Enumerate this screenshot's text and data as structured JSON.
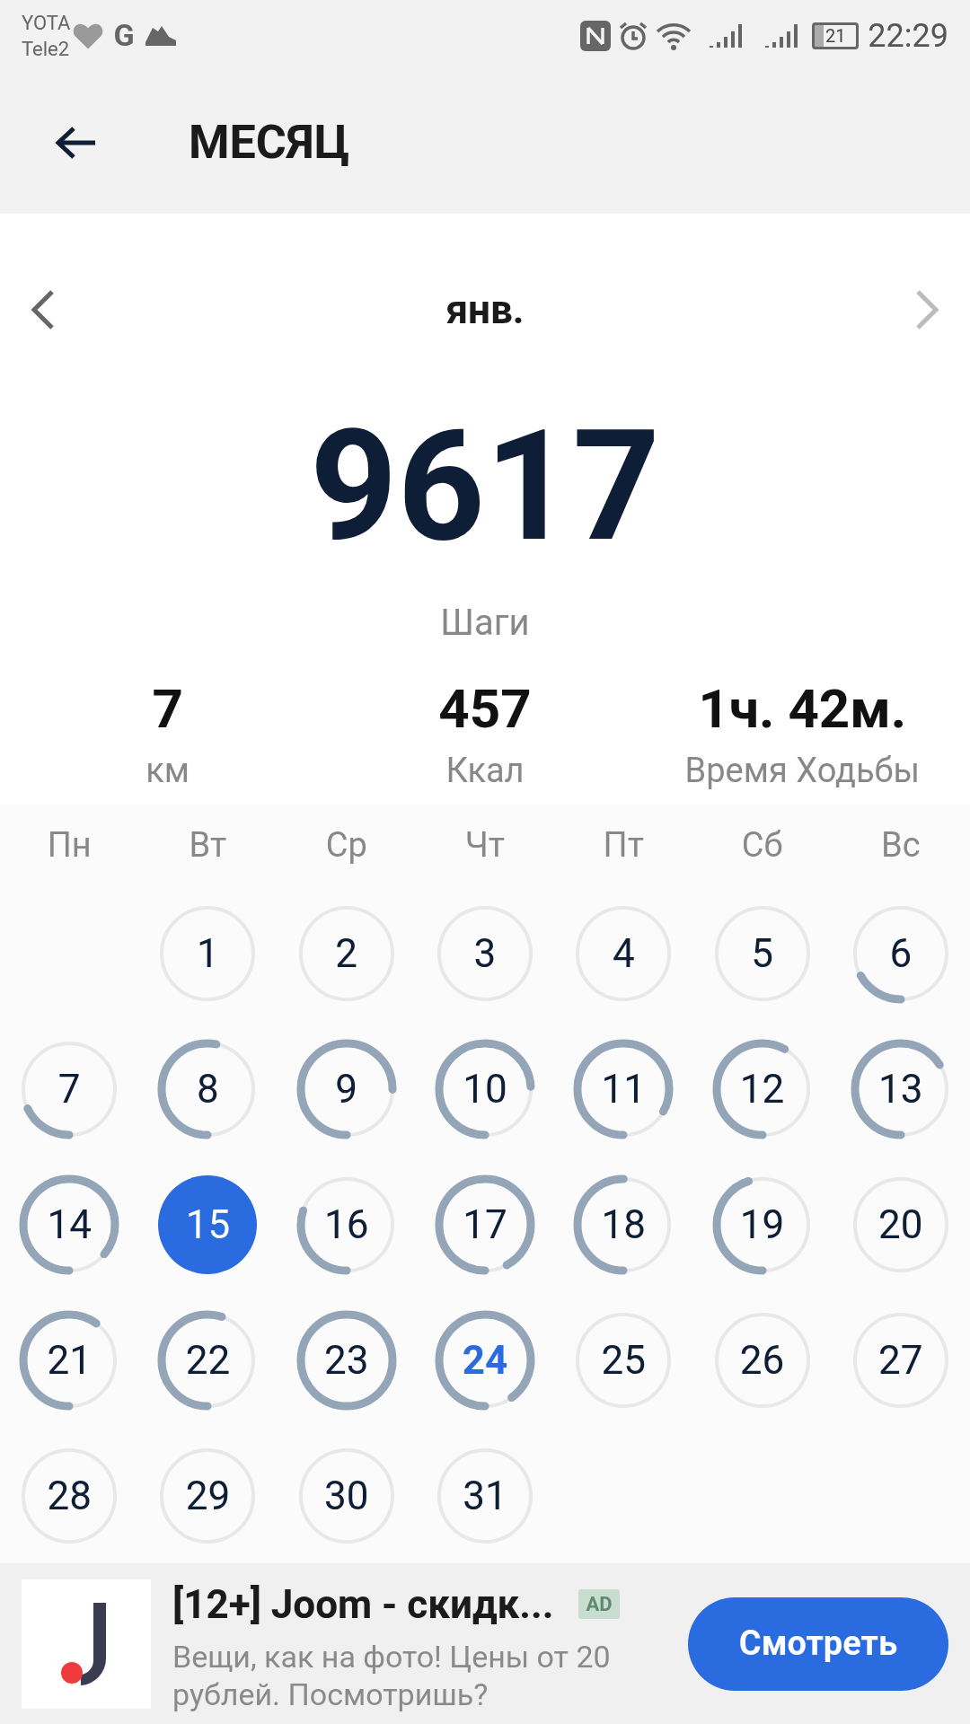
{
  "status_bar": {
    "carrier_1": "YOTA",
    "carrier_2": "Tele2",
    "g_icon": "G",
    "battery": "21",
    "time": "22:29"
  },
  "header": {
    "title": "МЕСЯЦ"
  },
  "month": {
    "label": "янв."
  },
  "summary": {
    "steps": "9617",
    "steps_label": "Шаги",
    "stats": [
      {
        "value": "7",
        "label": "км"
      },
      {
        "value": "457",
        "label": "Ккал"
      },
      {
        "value": "1ч. 42м.",
        "label": "Время Ходьбы"
      }
    ]
  },
  "calendar": {
    "weekdays": [
      "Пн",
      "Вт",
      "Ср",
      "Чт",
      "Пт",
      "Сб",
      "Вс"
    ],
    "days": [
      {
        "label": "1",
        "selected": false,
        "today": false
      },
      {
        "label": "2",
        "selected": false,
        "today": false
      },
      {
        "label": "3",
        "selected": false,
        "today": false
      },
      {
        "label": "4",
        "selected": false,
        "today": false
      },
      {
        "label": "5",
        "selected": false,
        "today": false
      },
      {
        "label": "6",
        "selected": false,
        "today": false
      },
      {
        "label": "7",
        "selected": false,
        "today": false
      },
      {
        "label": "8",
        "selected": false,
        "today": false
      },
      {
        "label": "9",
        "selected": false,
        "today": false
      },
      {
        "label": "10",
        "selected": false,
        "today": false
      },
      {
        "label": "11",
        "selected": false,
        "today": false
      },
      {
        "label": "12",
        "selected": false,
        "today": false
      },
      {
        "label": "13",
        "selected": false,
        "today": false
      },
      {
        "label": "14",
        "selected": false,
        "today": false
      },
      {
        "label": "15",
        "selected": true,
        "today": false
      },
      {
        "label": "16",
        "selected": false,
        "today": false
      },
      {
        "label": "17",
        "selected": false,
        "today": false
      },
      {
        "label": "18",
        "selected": false,
        "today": false
      },
      {
        "label": "19",
        "selected": false,
        "today": false
      },
      {
        "label": "20",
        "selected": false,
        "today": false
      },
      {
        "label": "21",
        "selected": false,
        "today": false
      },
      {
        "label": "22",
        "selected": false,
        "today": false
      },
      {
        "label": "23",
        "selected": false,
        "today": false
      },
      {
        "label": "24",
        "selected": false,
        "today": true
      },
      {
        "label": "25",
        "selected": false,
        "today": false
      },
      {
        "label": "26",
        "selected": false,
        "today": false
      },
      {
        "label": "27",
        "selected": false,
        "today": false
      },
      {
        "label": "28",
        "selected": false,
        "today": false
      },
      {
        "label": "29",
        "selected": false,
        "today": false
      },
      {
        "label": "30",
        "selected": false,
        "today": false
      },
      {
        "label": "31",
        "selected": false,
        "today": false
      }
    ]
  },
  "ad": {
    "title": "[12+] Joom - скидк...",
    "badge": "AD",
    "text": "Вещи, как на фото! Цены от 20 рублей. Посмотришь?",
    "button": "Смотреть"
  }
}
